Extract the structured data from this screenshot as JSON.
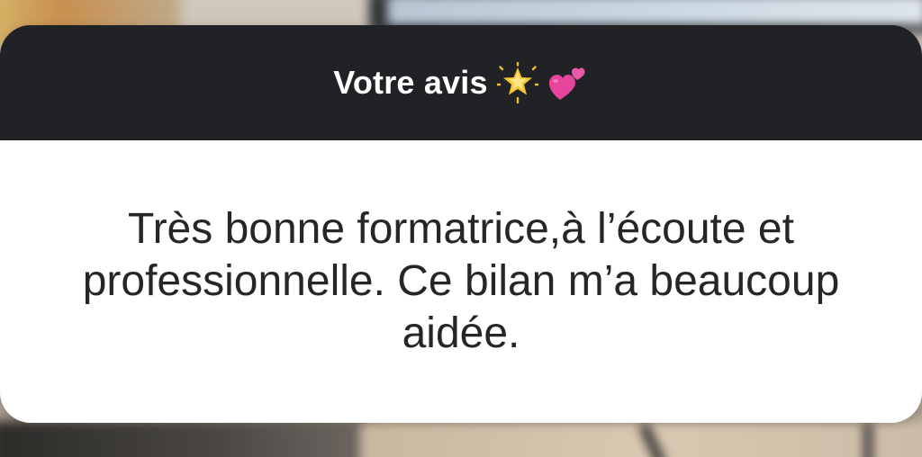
{
  "card": {
    "title": "Votre avis",
    "title_emojis": [
      "glowing-star-icon",
      "two-hearts-icon"
    ],
    "answer": "Très bonne formatrice,à l’écoute et professionnelle. Ce bilan m’a beaucoup aidée."
  },
  "colors": {
    "header_bg": "#212226",
    "body_bg": "#ffffff",
    "title_text": "#ffffff",
    "answer_text": "#262626"
  }
}
